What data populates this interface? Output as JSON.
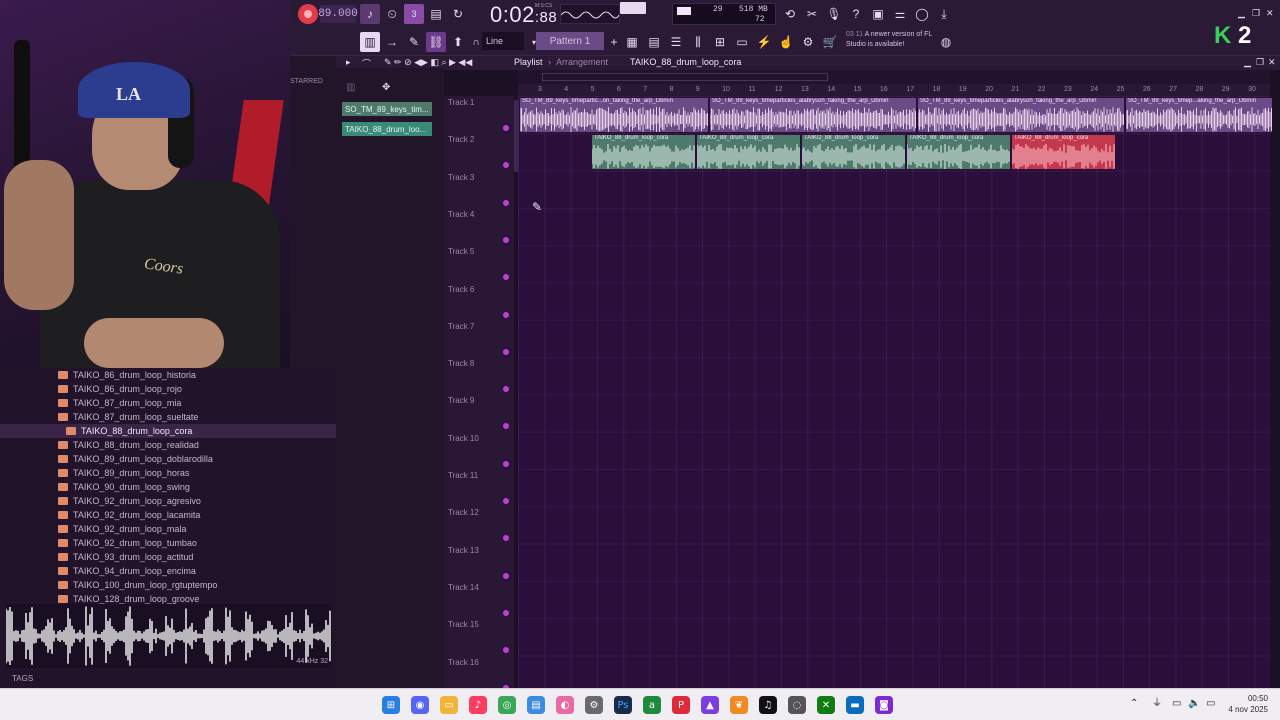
{
  "toolbar": {
    "tempo": "89.000",
    "clock_main": "0:02",
    "clock_ms": ":88",
    "clock_label": "M:S:CS",
    "memory": "518 MB",
    "cpu_voices": "29",
    "polyphony": "72",
    "snap": "Line",
    "pattern": "Pattern 1",
    "news_time": "03 11",
    "news_text": "A newer version of FL Studio is available!"
  },
  "webcam": {
    "cap_logo": "LA",
    "shirt_logo": "Coors"
  },
  "browser": {
    "starred_label": "STARRED",
    "items": [
      "TAIKO_86_drum_loop_historia",
      "TAIKO_86_drum_loop_rojo",
      "TAIKO_87_drum_loop_mia",
      "TAIKO_87_drum_loop_sueltate",
      "TAIKO_88_drum_loop_cora",
      "TAIKO_88_drum_loop_realidad",
      "TAIKO_89_drum_loop_doblarodilla",
      "TAIKO_89_drum_loop_horas",
      "TAIKO_90_drum_loop_swing",
      "TAIKO_92_drum_loop_agresivo",
      "TAIKO_92_drum_loop_lacamita",
      "TAIKO_92_drum_loop_mala",
      "TAIKO_92_drum_loop_tumbao",
      "TAIKO_93_drum_loop_actitud",
      "TAIKO_94_drum_loop_encima",
      "TAIKO_100_drum_loop_rgtuptempo",
      "TAIKO_128_drum_loop_groove"
    ],
    "selected_index": 4,
    "tags_label": "TAGS",
    "sample_rate": "44 kHz 32"
  },
  "playlist": {
    "title": "Playlist",
    "subtitle": "Arrangement",
    "clip_selector": "TAIKO_88_drum_loop_cora",
    "channels": [
      "SO_TM_89_keys_tim...",
      "TAIKO_88_drum_loo..."
    ],
    "tracks": [
      "Track 1",
      "Track 2",
      "Track 3",
      "Track 4",
      "Track 5",
      "Track 6",
      "Track 7",
      "Track 8",
      "Track 9",
      "Track 10",
      "Track 11",
      "Track 12",
      "Track 13",
      "Track 14",
      "Track 15",
      "Track 16"
    ],
    "ruler": [
      "3",
      "4",
      "5",
      "6",
      "7",
      "8",
      "9",
      "10",
      "11",
      "12",
      "13",
      "14",
      "15",
      "16",
      "17",
      "18",
      "19",
      "20",
      "21",
      "22",
      "23",
      "24",
      "25",
      "26",
      "27",
      "28",
      "29",
      "30"
    ],
    "track1_clips": [
      "SO_TM_89_keys_timepartic...on_faking_the_arp_Dbmin",
      "SO_TM_89_keys_timeparticles_alabryson_faking_the_arp_Dbmin",
      "SO_TM_89_keys_timeparticles_alabryson_faking_the_arp_Dbmin",
      "SO_TM_89_keys_timep...aking_the_arp_Dbmin"
    ],
    "track2_clips": [
      "TAIKO_88_drum_loop_cora",
      "TAIKO_88_drum_loop_cora",
      "TAIKO_88_drum_loop_cora",
      "TAIKO_88_drum_loop_cora",
      "TAIKO_88_drum_loop_cora"
    ]
  },
  "brand": {
    "k": "K",
    "n": "2"
  },
  "taskbar": {
    "time": "00:50",
    "date": "4 nov 2025"
  },
  "colors": {
    "accent": "#c43cd8",
    "keys_clip": "#6b4b86",
    "drum_clip": "#4e7a6e",
    "drum_clip_selected": "#c4384e"
  }
}
